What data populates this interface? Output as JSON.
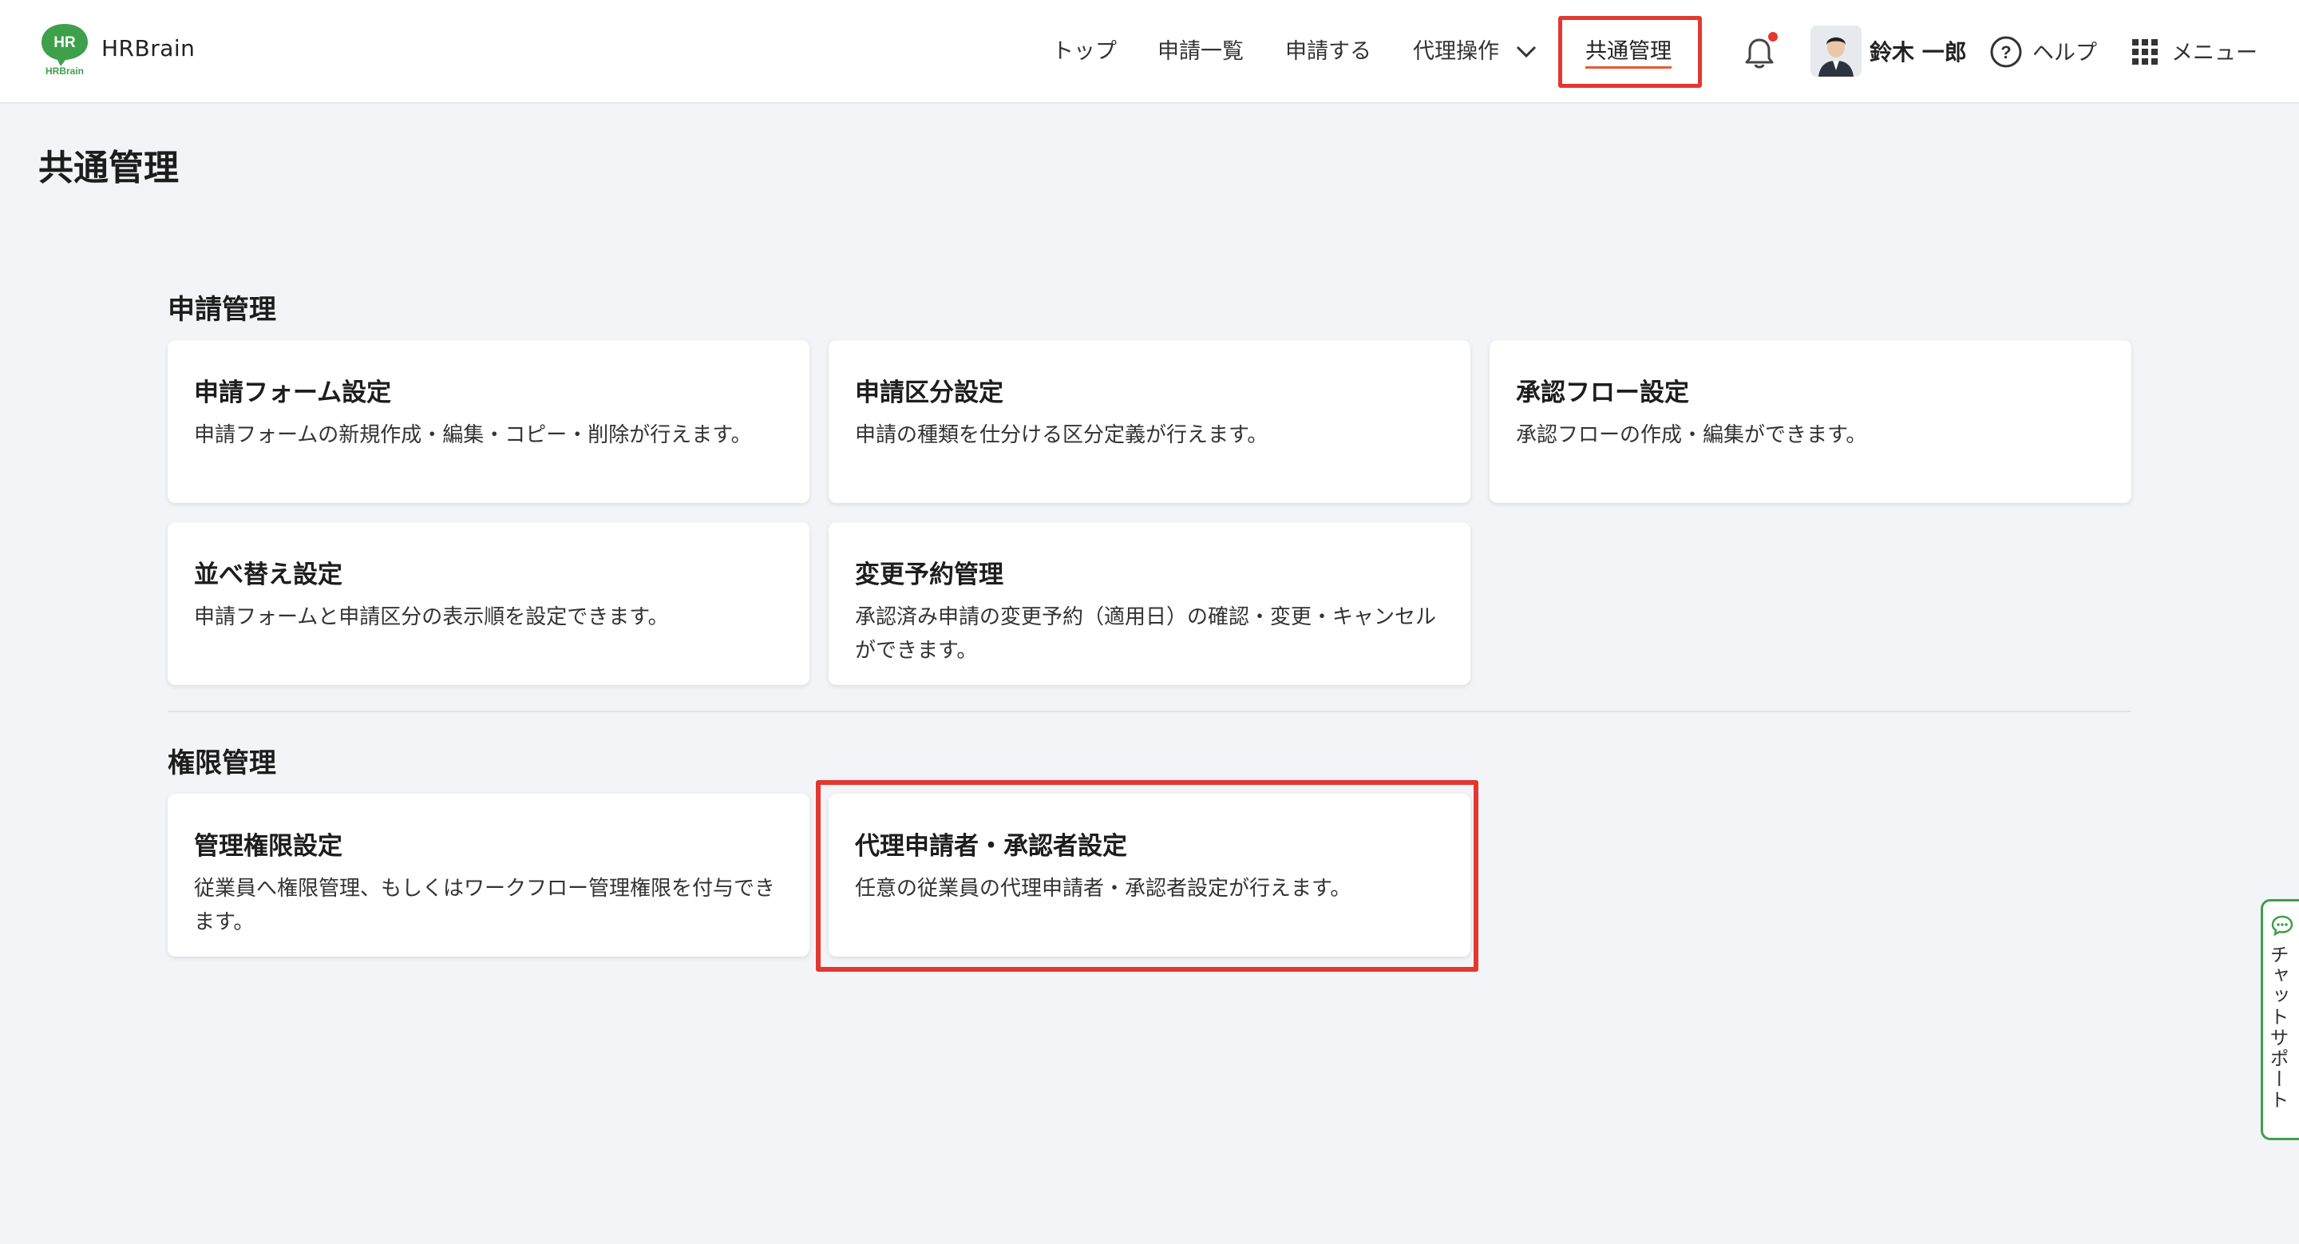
{
  "brand": {
    "logo_text": "HR",
    "logo_subtext": "HRBrain",
    "name": "HRBrain",
    "color": "#3ea04a"
  },
  "nav": {
    "items": [
      {
        "label": "トップ"
      },
      {
        "label": "申請一覧"
      },
      {
        "label": "申請する"
      },
      {
        "label": "代理操作"
      },
      {
        "label": "共通管理",
        "active": true
      }
    ],
    "accent_color": "#e85a35"
  },
  "header": {
    "user_name": "鈴木 一郎",
    "help_label": "ヘルプ",
    "menu_label": "メニュー",
    "notification_badge_color": "#e2382f"
  },
  "page": {
    "title": "共通管理"
  },
  "sections": [
    {
      "title": "申請管理",
      "cards": [
        {
          "title": "申請フォーム設定",
          "description": "申請フォームの新規作成・編集・コピー・削除が行えます。"
        },
        {
          "title": "申請区分設定",
          "description": "申請の種類を仕分ける区分定義が行えます。"
        },
        {
          "title": "承認フロー設定",
          "description": "承認フローの作成・編集ができます。"
        },
        {
          "title": "並べ替え設定",
          "description": "申請フォームと申請区分の表示順を設定できます。"
        },
        {
          "title": "変更予約管理",
          "description": "承認済み申請の変更予約（適用日）の確認・変更・キャンセルができます。"
        }
      ]
    },
    {
      "title": "権限管理",
      "cards": [
        {
          "title": "管理権限設定",
          "description": "従業員へ権限管理、もしくはワークフロー管理権限を付与できます。"
        },
        {
          "title": "代理申請者・承認者設定",
          "description": "任意の従業員の代理申請者・承認者設定が行えます。"
        }
      ]
    }
  ],
  "chat_support": {
    "label": "チャットサポート"
  },
  "highlight_color": "#e2382f"
}
